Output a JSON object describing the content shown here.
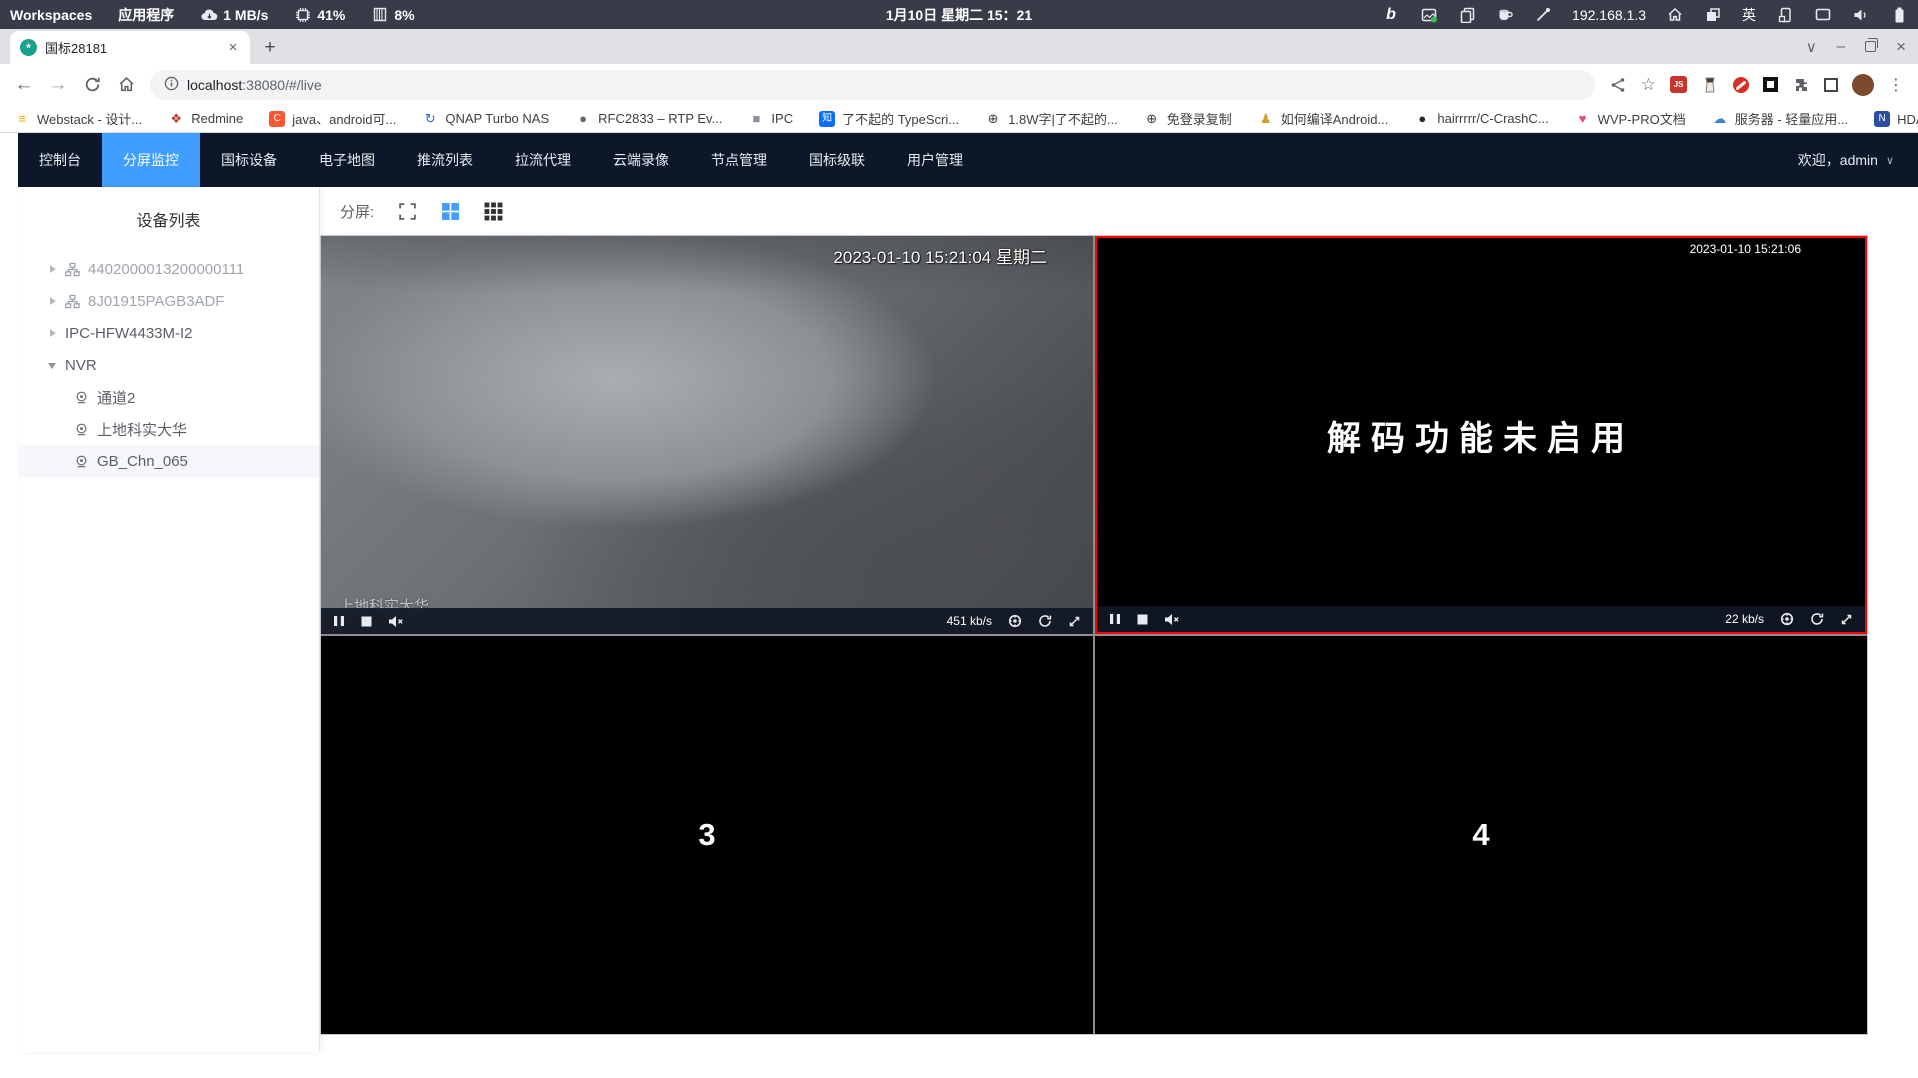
{
  "system_bar": {
    "workspaces_label": "Workspaces",
    "applications_label": "应用程序",
    "net_speed": "1 MB/s",
    "cpu_usage": "41%",
    "memory_usage": "8%",
    "clock": "1月10日 星期二 15：21",
    "bing_glyph": "b",
    "ip_address": "192.168.1.3",
    "input_method": "英"
  },
  "browser": {
    "tab_title": "国标28181",
    "favicon_glyph": "*",
    "url_host": "localhost",
    "url_path": ":38080/#/live",
    "bookmarks": [
      {
        "label": "Webstack - 设计...",
        "glyph": "≡",
        "fg": "#f0a818",
        "bg": "transparent"
      },
      {
        "label": "Redmine",
        "glyph": "❖",
        "fg": "#c0392b",
        "bg": "transparent"
      },
      {
        "label": "java、android可...",
        "glyph": "C",
        "fg": "#ffffff",
        "bg": "#fc5531"
      },
      {
        "label": "QNAP Turbo NAS",
        "glyph": "↻",
        "fg": "#1f6fc0",
        "bg": "transparent"
      },
      {
        "label": "RFC2833 – RTP Ev...",
        "glyph": "●",
        "fg": "#6e655c",
        "bg": "transparent"
      },
      {
        "label": "IPC",
        "glyph": "■",
        "fg": "#8a93a0",
        "bg": "transparent"
      },
      {
        "label": "了不起的 TypeScri...",
        "glyph": "知",
        "fg": "#ffffff",
        "bg": "#0b6cff"
      },
      {
        "label": "1.8W字|了不起的...",
        "glyph": "⊕",
        "fg": "#3c4043",
        "bg": "transparent"
      },
      {
        "label": "免登录复制",
        "glyph": "⊕",
        "fg": "#3c4043",
        "bg": "transparent"
      },
      {
        "label": "如何编译Android...",
        "glyph": "♟",
        "fg": "#c9a227",
        "bg": "transparent"
      },
      {
        "label": "hairrrrr/C-CrashC...",
        "glyph": "●",
        "fg": "#24292e",
        "bg": "transparent"
      },
      {
        "label": "WVP-PRO文档",
        "glyph": "♥",
        "fg": "#e8467c",
        "bg": "transparent"
      },
      {
        "label": "服务器 - 轻量应用...",
        "glyph": "☁",
        "fg": "#3b82d6",
        "bg": "transparent"
      },
      {
        "label": "HDAtmos :: 种子 *...",
        "glyph": "N",
        "fg": "#ffffff",
        "bg": "#2b4ea0"
      }
    ],
    "bookmarks_overflow": "»"
  },
  "icons": {
    "new_tab": "+",
    "tab_close": "×",
    "tab_search": "∨",
    "minimize": "–",
    "window_close": "×",
    "back": "←",
    "forward": "→",
    "star": "☆",
    "menu": "⋮",
    "welcome_caret": "∨"
  },
  "app": {
    "nav_items": [
      "控制台",
      "分屏监控",
      "国标设备",
      "电子地图",
      "推流列表",
      "拉流代理",
      "云端录像",
      "节点管理",
      "国标级联",
      "用户管理"
    ],
    "active_nav": "分屏监控",
    "welcome": "欢迎，admin"
  },
  "sidebar": {
    "title": "设备列表",
    "tree": [
      {
        "label": "4402000013200000111",
        "icon": "sitemap",
        "offline": true,
        "expandable": true
      },
      {
        "label": "8J01915PAGB3ADF",
        "icon": "sitemap",
        "offline": true,
        "expandable": true
      },
      {
        "label": "IPC-HFW4433M-I2",
        "expandable": true
      },
      {
        "label": "NVR",
        "expandable": true,
        "expanded": true,
        "children": [
          {
            "label": "通道2",
            "icon": "camera"
          },
          {
            "label": "上地科实大华",
            "icon": "camera"
          },
          {
            "label": "GB_Chn_065",
            "icon": "camera",
            "selected": true
          }
        ]
      }
    ]
  },
  "toolbar": {
    "split_label": "分屏:"
  },
  "video_grid": {
    "cells": [
      {
        "index": "1",
        "timestamp": "2023-01-10 15:21:04 星期二",
        "watermark": "上地科实大华",
        "bitrate": "451 kb/s"
      },
      {
        "index": "2",
        "timestamp": "2023-01-10 15:21:06",
        "message": "解码功能未启用",
        "bitrate": "22 kb/s"
      },
      {
        "index": "3",
        "placeholder": "3"
      },
      {
        "index": "4",
        "placeholder": "4"
      }
    ]
  },
  "colors": {
    "accent": "#409eff",
    "nav_bg": "#0c1829",
    "selected_border": "#ff0000"
  }
}
